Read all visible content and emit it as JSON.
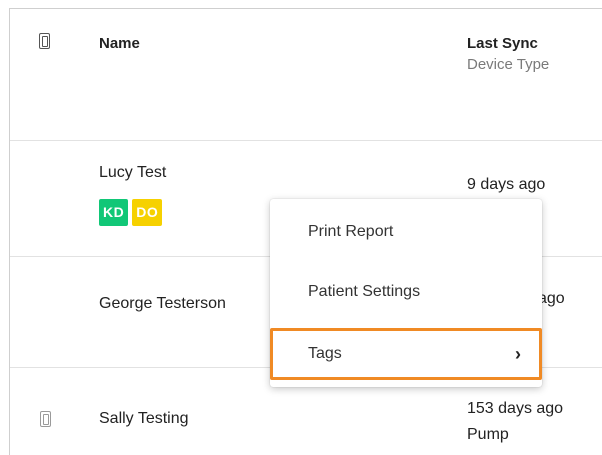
{
  "table": {
    "headers": {
      "name": "Name",
      "last_sync": "Last Sync",
      "device_type": "Device Type"
    },
    "rows": [
      {
        "name": "Lucy Test",
        "last_sync": "9 days ago",
        "device_type": "",
        "tags": [
          "KD",
          "DO"
        ]
      },
      {
        "name": "George Testerson",
        "last_sync": "ago",
        "device_type": "",
        "tags": []
      },
      {
        "name": "Sally Testing",
        "last_sync": "153 days ago",
        "device_type": "Pump",
        "tags": []
      }
    ]
  },
  "context_menu": {
    "items": [
      {
        "label": "Print Report"
      },
      {
        "label": "Patient Settings"
      },
      {
        "label": "Tags",
        "submenu_icon": "chevron-right-icon"
      }
    ]
  },
  "colors": {
    "tag_green": "#11c777",
    "tag_yellow": "#f6d100",
    "highlight_orange": "#f08a24"
  }
}
